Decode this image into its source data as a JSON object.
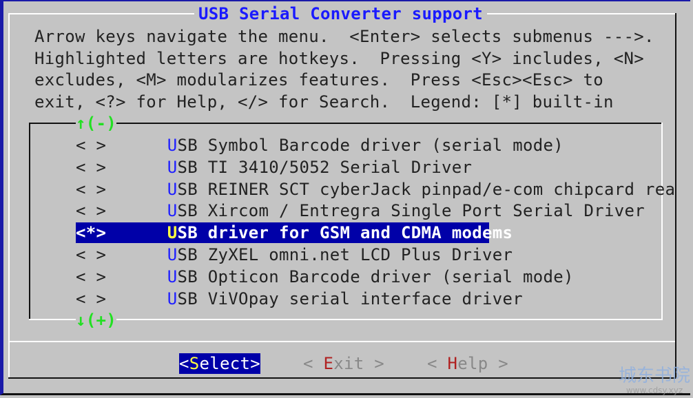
{
  "title": "USB Serial Converter support",
  "help_lines": [
    "Arrow keys navigate the menu.  <Enter> selects submenus --->.",
    "Highlighted letters are hotkeys.  Pressing <Y> includes, <N>",
    "excludes, <M> modularizes features.  Press <Esc><Esc> to",
    "exit, <?> for Help, </> for Search.  Legend: [*] built-in"
  ],
  "scroll_up": "↑(-)",
  "scroll_down": "↓(+)",
  "menu_items": [
    {
      "state": "< >",
      "hotkey": "U",
      "rest": "SB Symbol Barcode driver (serial mode)",
      "selected": false
    },
    {
      "state": "< >",
      "hotkey": "U",
      "rest": "SB TI 3410/5052 Serial Driver",
      "selected": false
    },
    {
      "state": "< >",
      "hotkey": "U",
      "rest": "SB REINER SCT cyberJack pinpad/e-com chipcard rea",
      "selected": false
    },
    {
      "state": "< >",
      "hotkey": "U",
      "rest": "SB Xircom / Entregra Single Port Serial Driver",
      "selected": false
    },
    {
      "state": "<*>",
      "hotkey": "U",
      "rest": "SB driver for GSM and CDMA modems",
      "selected": true
    },
    {
      "state": "< >",
      "hotkey": "U",
      "rest": "SB ZyXEL omni.net LCD Plus Driver",
      "selected": false
    },
    {
      "state": "< >",
      "hotkey": "U",
      "rest": "SB Opticon Barcode driver (serial mode)",
      "selected": false
    },
    {
      "state": "< >",
      "hotkey": "U",
      "rest": "SB ViVOpay serial interface driver",
      "selected": false
    }
  ],
  "buttons": [
    {
      "pre": "<",
      "hotkey": "S",
      "rest": "elect>",
      "active": true
    },
    {
      "pre": "< ",
      "hotkey": "E",
      "rest": "xit >",
      "active": false
    },
    {
      "pre": "< ",
      "hotkey": "H",
      "rest": "elp >",
      "active": false
    }
  ],
  "watermark": {
    "line1": "城东书院",
    "line2": "www.cdsy.xyz"
  },
  "colors": {
    "background": "#c4c4c4",
    "highlight": "#0000a8",
    "hotkey": "#2020ff",
    "title": "#1a1aff",
    "scroll_arrows": "#22e022"
  }
}
